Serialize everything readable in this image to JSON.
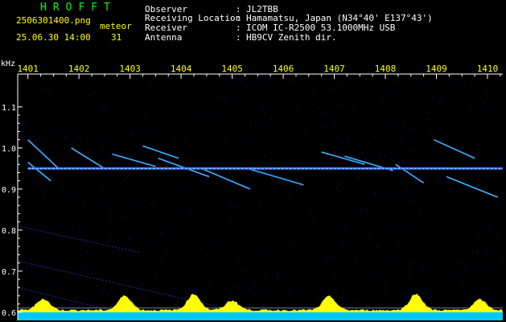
{
  "app_title": "HROFFT",
  "file_name": "2506301400.png",
  "meteor_label": "meteor",
  "datetime": "25.06.30 14:00",
  "meteor_count": "31",
  "info": [
    {
      "label": "Observer",
      "sep": ":",
      "value": "JL2TBB"
    },
    {
      "label": "Receiving Location",
      "sep": ":",
      "value": "Hamamatsu, Japan (N34°40' E137°43')"
    },
    {
      "label": "Receiver",
      "sep": ":",
      "value": "ICOM IC-R2500 53.1000MHz USB"
    },
    {
      "label": "Antenna",
      "sep": ":",
      "value": "HB9CV Zenith dir."
    }
  ],
  "colors": {
    "header_accent": "#ffff00",
    "title": "#00ff00",
    "carrier": "#2f6bff",
    "echo": "#40e0e0",
    "spectrum_fill": "#ffff00",
    "spectrum_base": "#00c8ff"
  },
  "chart_data": {
    "type": "heatmap",
    "title": "",
    "xlabel": "",
    "ylabel": "kHz",
    "x_ticks": [
      "1401",
      "1402",
      "1403",
      "1404",
      "1405",
      "1406",
      "1407",
      "1408",
      "1409",
      "1410"
    ],
    "y_ticks": [
      "1.1",
      "1.0",
      "0.9",
      "0.8",
      "0.7",
      "0.6"
    ],
    "x_range": [
      1400.8,
      1410.3
    ],
    "y_range": [
      0.58,
      1.18
    ],
    "carrier_khz": 0.95,
    "meteor_traces": [
      {
        "t0": 1401.0,
        "f0": 1.02,
        "t1": 1401.6,
        "f1": 0.95
      },
      {
        "t0": 1401.0,
        "f0": 0.965,
        "t1": 1401.45,
        "f1": 0.92
      },
      {
        "t0": 1401.85,
        "f0": 1.0,
        "t1": 1402.5,
        "f1": 0.95
      },
      {
        "t0": 1402.65,
        "f0": 0.985,
        "t1": 1403.5,
        "f1": 0.955
      },
      {
        "t0": 1403.25,
        "f0": 1.005,
        "t1": 1403.95,
        "f1": 0.975
      },
      {
        "t0": 1403.55,
        "f0": 0.975,
        "t1": 1404.55,
        "f1": 0.93
      },
      {
        "t0": 1404.4,
        "f0": 0.95,
        "t1": 1405.35,
        "f1": 0.9
      },
      {
        "t0": 1405.3,
        "f0": 0.95,
        "t1": 1406.4,
        "f1": 0.91
      },
      {
        "t0": 1406.75,
        "f0": 0.99,
        "t1": 1407.6,
        "f1": 0.96
      },
      {
        "t0": 1407.2,
        "f0": 0.98,
        "t1": 1408.15,
        "f1": 0.945
      },
      {
        "t0": 1408.2,
        "f0": 0.96,
        "t1": 1408.75,
        "f1": 0.915
      },
      {
        "t0": 1408.95,
        "f0": 1.02,
        "t1": 1409.75,
        "f1": 0.975
      },
      {
        "t0": 1409.2,
        "f0": 0.93,
        "t1": 1410.2,
        "f1": 0.88
      }
    ],
    "faint_drifts": [
      {
        "t0": 1400.8,
        "f0": 0.81,
        "t1": 1403.2,
        "f1": 0.745
      },
      {
        "t0": 1400.8,
        "f0": 0.725,
        "t1": 1405.2,
        "f1": 0.6
      },
      {
        "t0": 1400.8,
        "f0": 0.66,
        "t1": 1402.6,
        "f1": 0.605
      }
    ],
    "spectrum_bursts": [
      {
        "t": 1401.3,
        "level": 0.7
      },
      {
        "t": 1402.9,
        "level": 0.9
      },
      {
        "t": 1404.25,
        "level": 1.0
      },
      {
        "t": 1405.0,
        "level": 0.6
      },
      {
        "t": 1406.9,
        "level": 0.85
      },
      {
        "t": 1408.6,
        "level": 1.0
      },
      {
        "t": 1409.85,
        "level": 0.65
      }
    ],
    "grid": false
  }
}
